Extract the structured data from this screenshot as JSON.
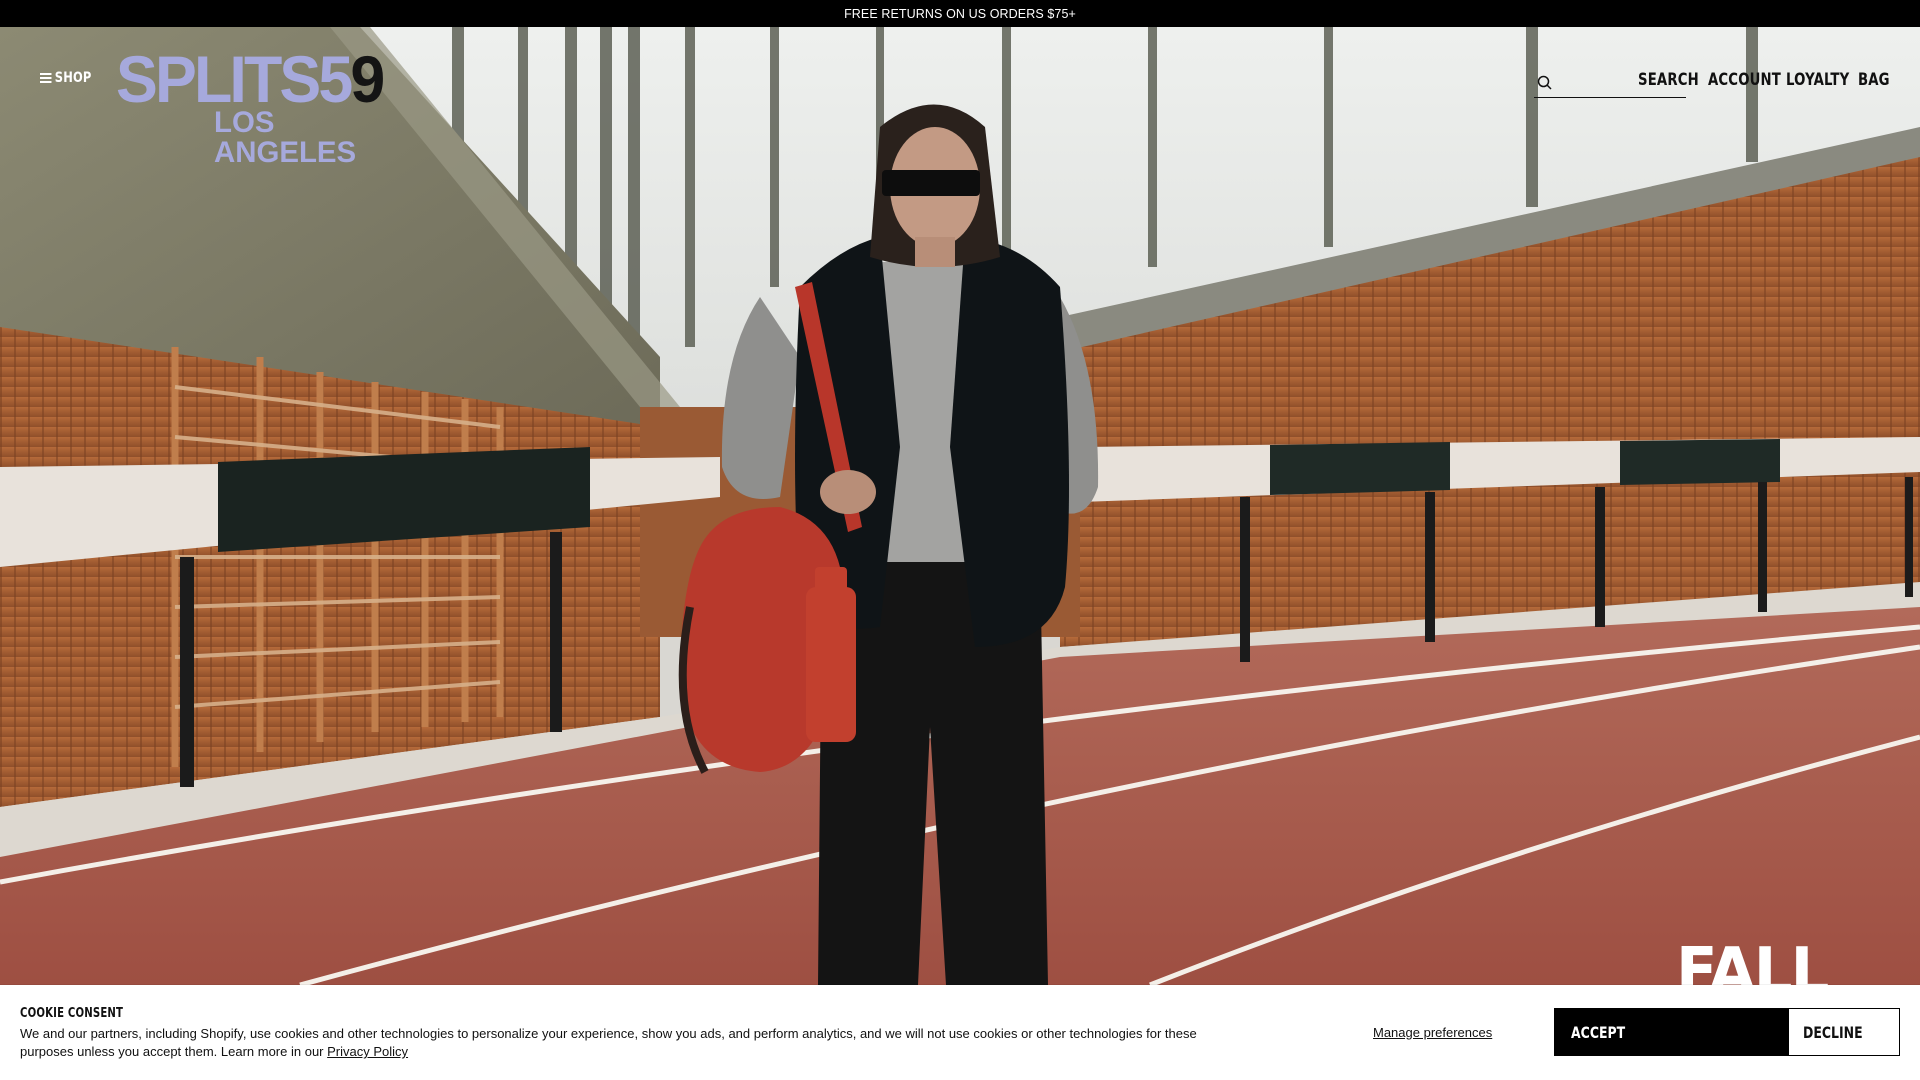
{
  "announcement": {
    "text": "FREE RETURNS ON US ORDERS $75+"
  },
  "header": {
    "shop_label": "SHOP",
    "logo": {
      "line1_main": "SPLITS5",
      "line1_last": "9",
      "line2": "LOS ANGELES"
    },
    "search_placeholder": "",
    "nav": {
      "search": "SEARCH",
      "account": "ACCOUNT",
      "loyalty": "LOYALTY",
      "bag": "BAG"
    }
  },
  "hero": {
    "headline_fragment": "FALL"
  },
  "cookie": {
    "title": "COOKIE CONSENT",
    "body_line1": "We and our partners, including Shopify, use cookies and other technologies to personalize your experience, show you ads, and perform analytics, and we will not use cookies or other technologies for these",
    "body_line2": "purposes unless you accept them. Learn more in our ",
    "privacy_link": "Privacy Policy",
    "manage_label": "Manage preferences",
    "accept_label": "ACCEPT",
    "decline_label": "DECLINE"
  },
  "colors": {
    "logo_lavender": "#a6a9dc",
    "track_red": "#a9574a",
    "wood": "#a0582f",
    "banner_black": "#000000"
  },
  "icons": {
    "menu": "hamburger-icon",
    "search": "search-icon"
  }
}
